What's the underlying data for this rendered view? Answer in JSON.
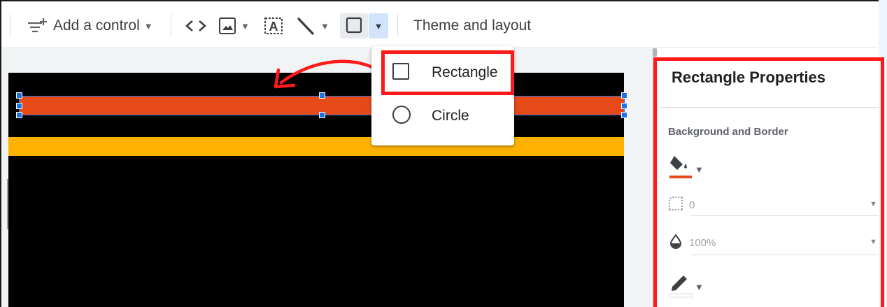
{
  "toolbar": {
    "add_control_label": "Add a control",
    "theme_layout_label": "Theme and layout"
  },
  "shape_menu": {
    "items": [
      {
        "label": "Rectangle",
        "icon": "square-outline-icon"
      },
      {
        "label": "Circle",
        "icon": "circle-outline-icon"
      }
    ]
  },
  "panel": {
    "title": "Rectangle Properties",
    "section_label": "Background and Border",
    "fill_color": "#e64a19",
    "border_radius_value": "0",
    "opacity_value": "100%"
  },
  "colors": {
    "highlight": "#ff1a1a",
    "selection": "#1a73e8",
    "orange_bar": "#e64a19",
    "yellow_bar": "#ffb300",
    "canvas": "#000000"
  }
}
